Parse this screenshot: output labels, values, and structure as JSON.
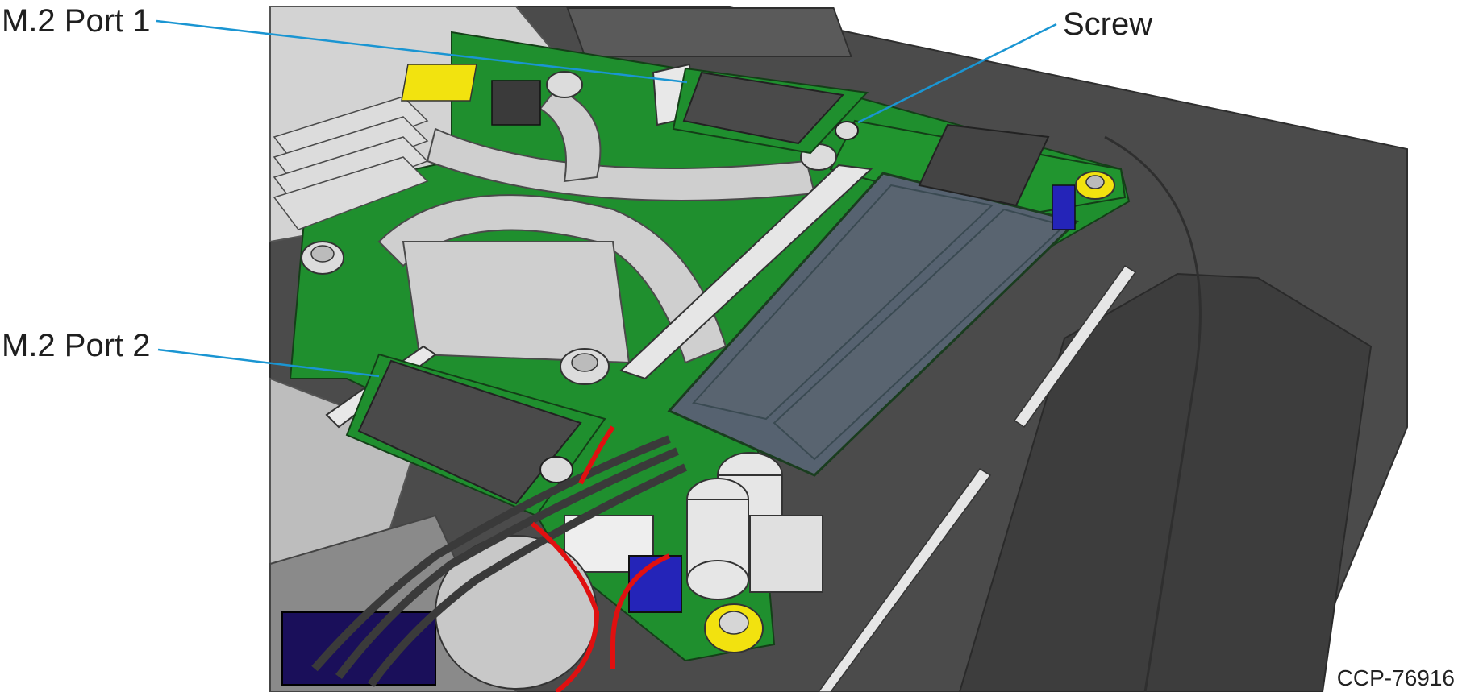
{
  "callouts": {
    "m2_port_1": "M.2 Port 1",
    "m2_port_2": "M.2 Port 2",
    "screw": "Screw"
  },
  "figure_code": "CCP-76916",
  "colors": {
    "leader_line": "#1a95d2",
    "pcb_green": "#1f8f2e",
    "chassis_dark": "#4a4a4a",
    "heatsink_gray": "#c8c8c8",
    "memory_module": "#566270",
    "m2_card": "#4a4a4a",
    "standoff_yellow": "#f2e20f",
    "cable_red": "#e01010",
    "connector_blue": "#1a1aa8",
    "connector_yellow": "#f2e30f"
  }
}
